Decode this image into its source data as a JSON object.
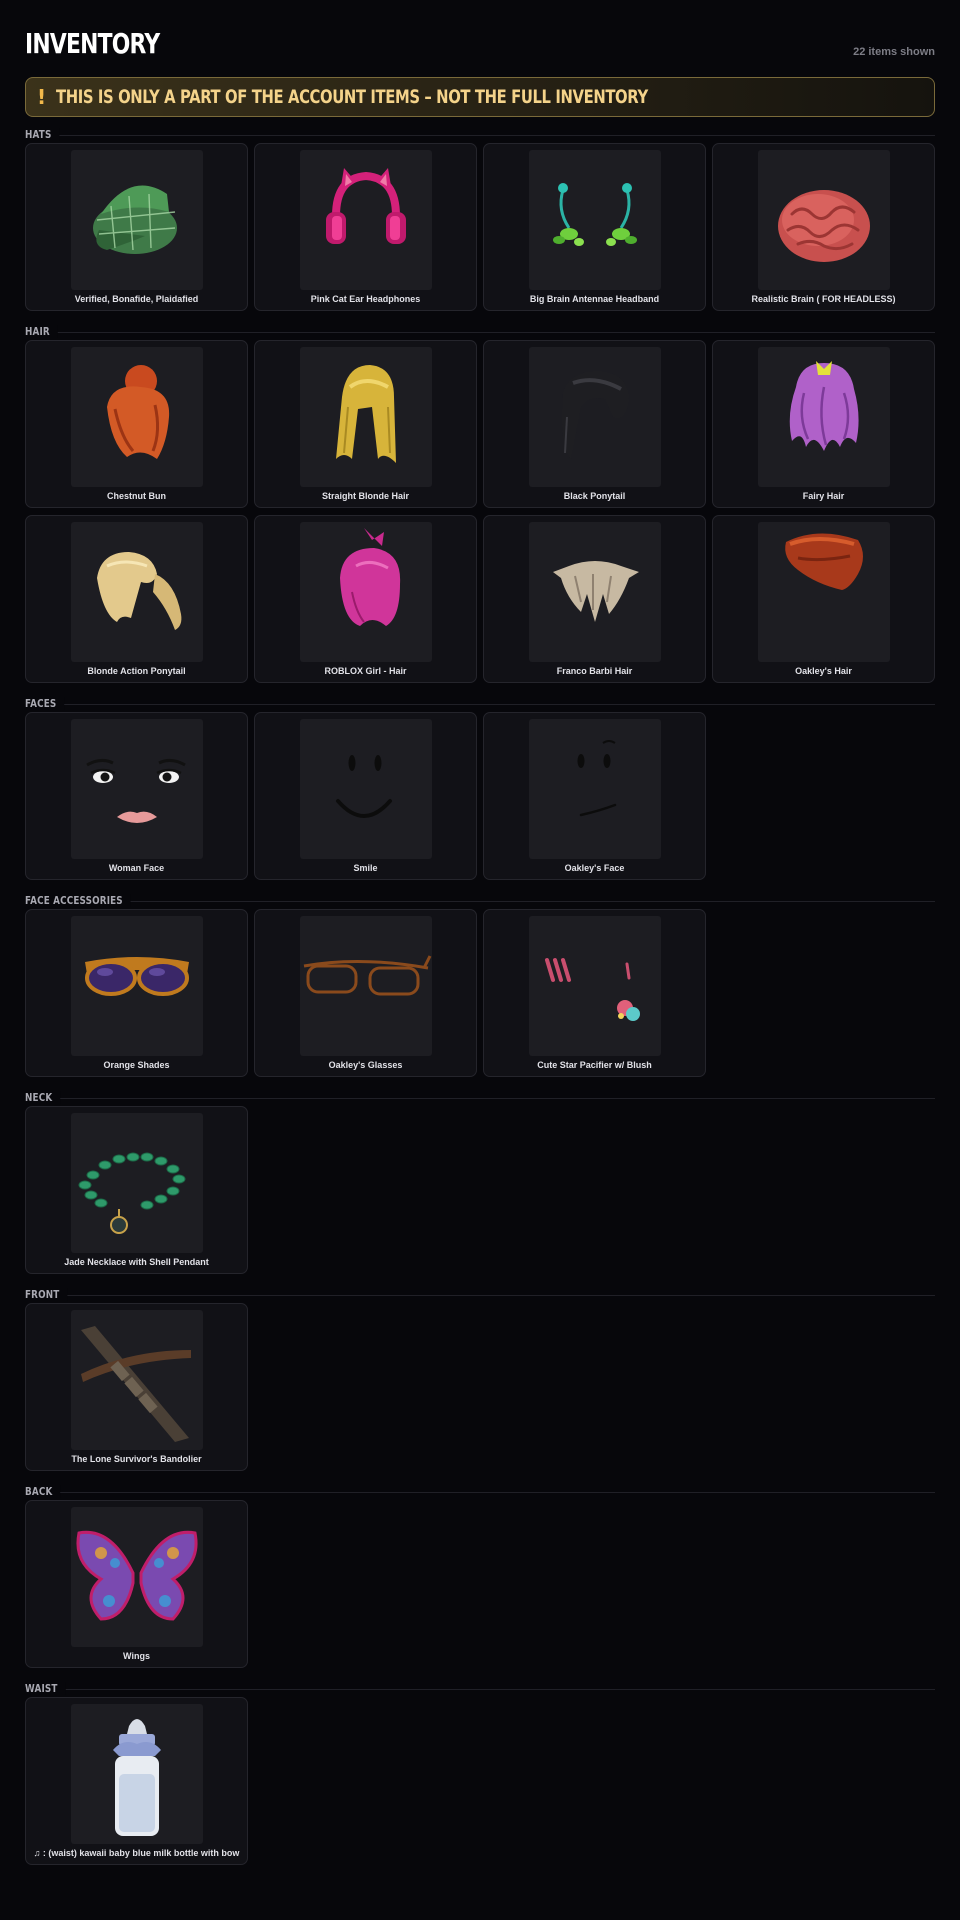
{
  "header": {
    "title": "INVENTORY",
    "count": "22 items shown"
  },
  "banner": {
    "icon": "!",
    "text": "THIS IS ONLY A PART OF THE ACCOUNT ITEMS – NOT THE FULL INVENTORY"
  },
  "sections": {
    "hats": {
      "label": "HATS",
      "items": [
        {
          "name": "Verified, Bonafide, Plaidafied",
          "icon": "plaid-cap-icon"
        },
        {
          "name": "Pink Cat Ear Headphones",
          "icon": "cat-headphones-icon"
        },
        {
          "name": "Big Brain Antennae Headband",
          "icon": "antennae-icon"
        },
        {
          "name": "Realistic Brain ( FOR HEADLESS)",
          "icon": "brain-icon"
        }
      ]
    },
    "hair": {
      "label": "HAIR",
      "items": [
        {
          "name": "Chestnut Bun",
          "icon": "chestnut-bun-icon"
        },
        {
          "name": "Straight Blonde Hair",
          "icon": "blonde-hair-icon"
        },
        {
          "name": "Black Ponytail",
          "icon": "black-ponytail-icon"
        },
        {
          "name": "Fairy Hair",
          "icon": "fairy-hair-icon"
        },
        {
          "name": "Blonde Action Ponytail",
          "icon": "blonde-ponytail-icon"
        },
        {
          "name": "ROBLOX Girl - Hair",
          "icon": "pink-hair-icon"
        },
        {
          "name": "Franco Barbi Hair",
          "icon": "franco-hair-icon"
        },
        {
          "name": "Oakley's Hair",
          "icon": "oakley-hair-icon"
        }
      ]
    },
    "faces": {
      "label": "FACES",
      "items": [
        {
          "name": "Woman Face",
          "icon": "woman-face-icon"
        },
        {
          "name": "Smile",
          "icon": "smile-face-icon"
        },
        {
          "name": "Oakley's Face",
          "icon": "oakley-face-icon"
        }
      ]
    },
    "face_accessories": {
      "label": "FACE ACCESSORIES",
      "items": [
        {
          "name": "Orange Shades",
          "icon": "shades-icon"
        },
        {
          "name": "Oakley's Glasses",
          "icon": "glasses-icon"
        },
        {
          "name": "Cute Star Pacifier w/ Blush",
          "icon": "pacifier-icon"
        }
      ]
    },
    "neck": {
      "label": "NECK",
      "items": [
        {
          "name": "Jade Necklace with Shell Pendant",
          "icon": "necklace-icon"
        }
      ]
    },
    "front": {
      "label": "FRONT",
      "items": [
        {
          "name": "The Lone Survivor's Bandolier",
          "icon": "bandolier-icon"
        }
      ]
    },
    "back": {
      "label": "BACK",
      "items": [
        {
          "name": "Wings",
          "icon": "wings-icon"
        }
      ]
    },
    "waist": {
      "label": "WAIST",
      "items": [
        {
          "name": "♫ : (waist) kawaii baby blue milk bottle with bow",
          "icon": "milk-bottle-icon"
        }
      ]
    }
  }
}
